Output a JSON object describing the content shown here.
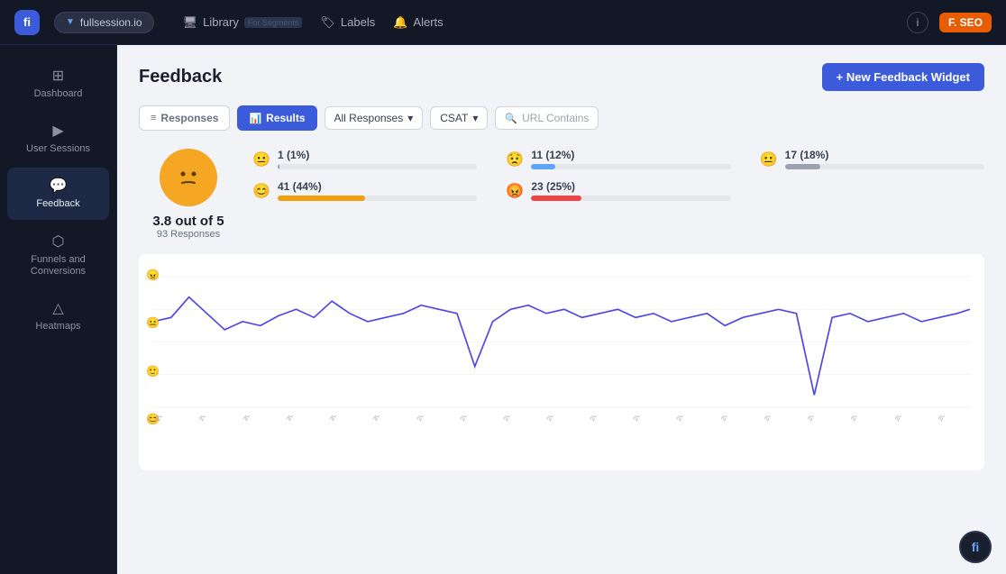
{
  "topbar": {
    "logo_text": "fi",
    "workspace": "fullsession.io",
    "nav_items": [
      {
        "label": "Library",
        "icon": "🖥"
      },
      {
        "label": "Labels",
        "icon": "🏷"
      },
      {
        "label": "Alerts",
        "icon": "🔔"
      }
    ],
    "info_icon": "i",
    "user_label": "F. SEO"
  },
  "sidebar": {
    "items": [
      {
        "label": "Dashboard",
        "icon": "⊞",
        "active": false
      },
      {
        "label": "User Sessions",
        "icon": "▶",
        "active": false
      },
      {
        "label": "Feedback",
        "icon": "💬",
        "active": true
      },
      {
        "label": "Funnels and Conversions",
        "icon": "⬡",
        "active": false
      },
      {
        "label": "Heatmaps",
        "icon": "△",
        "active": false
      }
    ]
  },
  "page": {
    "title": "Feedback",
    "new_widget_btn": "+ New Feedback Widget"
  },
  "filters": {
    "responses_tab": "Responses",
    "results_tab": "Results",
    "all_responses": "All Responses",
    "csat": "CSAT",
    "search_placeholder": "URL Contains"
  },
  "score": {
    "value": "3.8 out of 5",
    "responses": "93 Responses",
    "emoji": "😐"
  },
  "ratings": [
    {
      "emoji": "😐",
      "label": "1 (1%)",
      "pct": 1,
      "color": "#9ca3af"
    },
    {
      "emoji": "😊",
      "label": "41 (44%)",
      "pct": 44,
      "color": "#f59e0b"
    },
    {
      "emoji": "😟",
      "label": "11 (12%)",
      "pct": 12,
      "color": "#60a5fa"
    },
    {
      "emoji": "😡",
      "label": "23 (25%)",
      "pct": 25,
      "color": "#ef4444"
    },
    {
      "emoji": "😐",
      "label": "17 (18%)",
      "pct": 18,
      "color": "#9ca3af"
    },
    {
      "emoji": "",
      "label": "",
      "pct": 0,
      "color": ""
    }
  ],
  "chart": {
    "y_icons": [
      "😠",
      "😐",
      "🙂",
      "😊"
    ],
    "color": "#4f46e5",
    "dates": [
      "2021-12-05",
      "2021-12-19",
      "2022-01-07",
      "2022-01-10",
      "2022-01-18",
      "2022-01-24",
      "2022-01-28",
      "2022-02-04",
      "2022-02-13",
      "2022-02-24",
      "2022-02-26",
      "2022-03-14",
      "2022-03-24",
      "2022-04-05",
      "2022-04-15",
      "2022-04-27",
      "2022-05-10",
      "2022-05-13",
      "2022-06-01",
      "2022-06-13",
      "2022-07-11",
      "2022-08-01",
      "2022-09-05",
      "2022-10-11",
      "2022-11-01",
      "2022-12-06",
      "2022-12-12",
      "2022-12-18",
      "2022-12-22",
      "2023-01-06",
      "2023-01-13",
      "2023-02-05",
      "2023-03-07",
      "2023-03-14",
      "2023-03-21",
      "2023-03-30",
      "2023-04-06",
      "2023-04-13",
      "2023-05-06",
      "2023-05-18",
      "2023-06-06",
      "2023-06-14",
      "2023-08-18",
      "2023-09-06",
      "2023-09-27"
    ]
  },
  "bottom_logo": "fi"
}
